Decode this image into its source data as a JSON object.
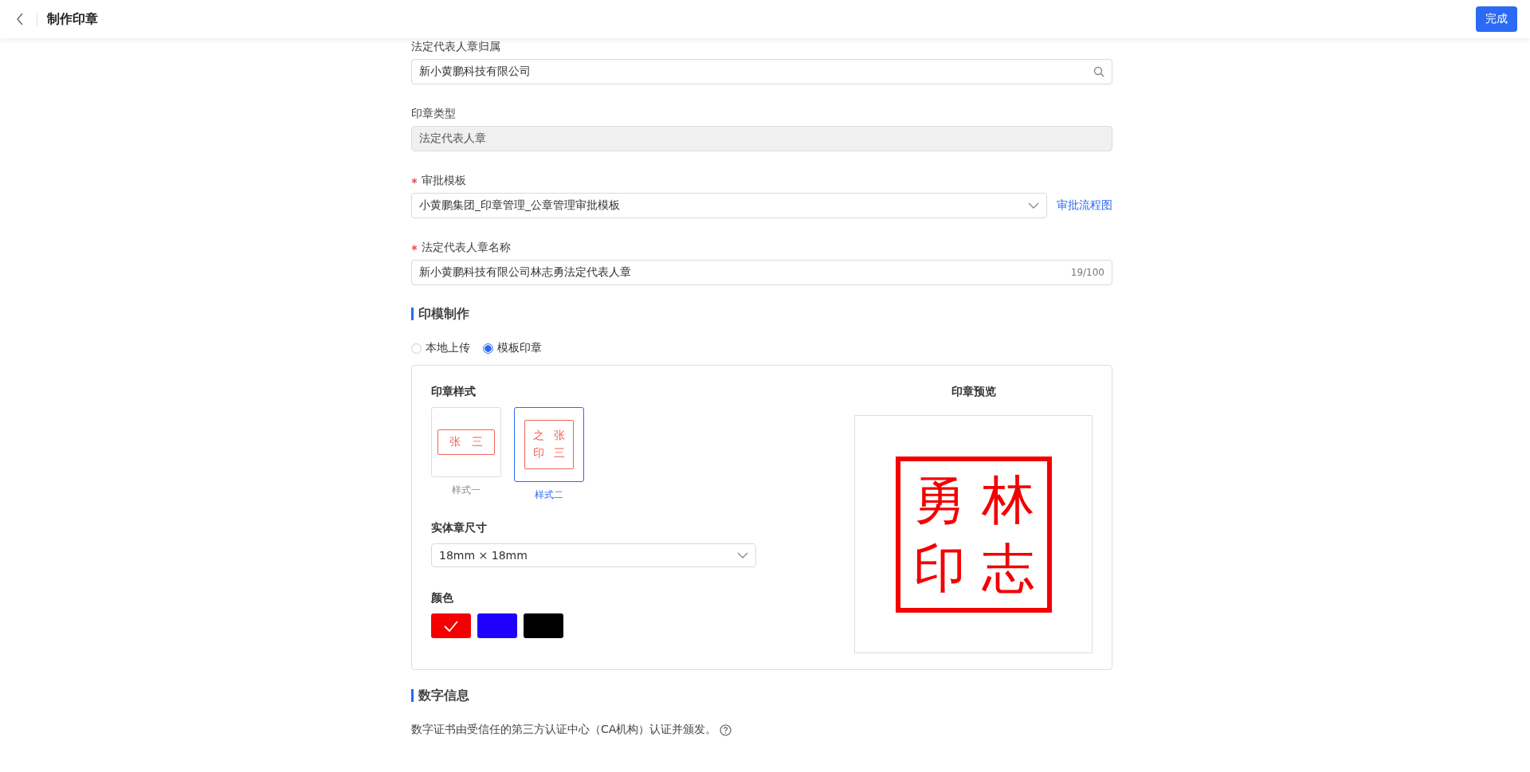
{
  "header": {
    "title": "制作印章",
    "done_button": "完成"
  },
  "fields": [
    {
      "kind": "search",
      "label": "法定代表人章归属",
      "required": false,
      "value": "新小黄鹏科技有限公司",
      "disabled": false
    },
    {
      "kind": "text",
      "label": "印章类型",
      "required": false,
      "value": "法定代表人章",
      "disabled": true
    },
    {
      "kind": "select",
      "label": "审批模板",
      "required": true,
      "value": "小黄鹏集团_印章管理_公章管理审批模板",
      "link": "审批流程图",
      "disabled": false
    },
    {
      "kind": "counter",
      "label": "法定代表人章名称",
      "required": true,
      "value": "新小黄鹏科技有限公司林志勇法定代表人章",
      "count": "19/100",
      "disabled": false
    }
  ],
  "seal_section": {
    "title": "印模制作",
    "source_options": [
      {
        "label": "本地上传",
        "selected": false
      },
      {
        "label": "模板印章",
        "selected": true
      }
    ],
    "style_label": "印章样式",
    "styles": [
      {
        "kind": "horizontal",
        "characters": [
          "张",
          "三"
        ],
        "label": "样式一",
        "selected": false
      },
      {
        "kind": "square",
        "characters": [
          "之",
          "张",
          "印",
          "三"
        ],
        "label": "样式二",
        "selected": true
      }
    ],
    "size_label": "实体章尺寸",
    "size_value": "18mm × 18mm",
    "color_label": "颜色",
    "colors": [
      {
        "color": "#f50000",
        "selected": true
      },
      {
        "color": "#1f00ff",
        "selected": false
      },
      {
        "color": "#000000",
        "selected": false
      }
    ],
    "preview_title": "印章预览",
    "preview_characters": [
      "勇",
      "林",
      "印",
      "志"
    ]
  },
  "digital_section": {
    "title": "数字信息",
    "description": "数字证书由受信任的第三方认证中心（CA机构）认证并颁发。"
  }
}
